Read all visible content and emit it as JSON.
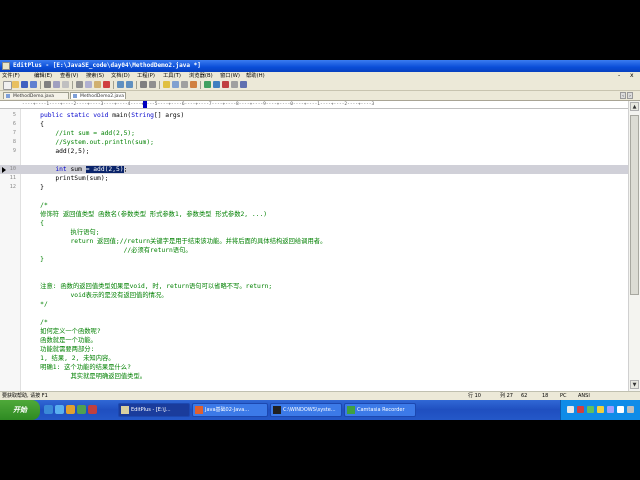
{
  "window": {
    "title": "EditPlus - [E:\\JavaSE_code\\day04\\MethodDemo2.java *]"
  },
  "menu": {
    "items": [
      "文件(F)",
      "编辑(E)",
      "查看(V)",
      "搜索(S)",
      "文档(D)",
      "工程(P)",
      "工具(T)",
      "浏览器(B)",
      "窗口(W)",
      "帮助(H)"
    ],
    "controls": [
      "-",
      "x"
    ]
  },
  "tabs": [
    {
      "label": "MethodDemo.java",
      "active": false
    },
    {
      "label": "MethodDemo2.java",
      "active": true
    }
  ],
  "ruler": {
    "text": "----+----1----+----2----+----3----+----4----+----5----+----6----+----7----+----8----+----9----+----0----+----1----+----2----+----3"
  },
  "editor": {
    "current_line": 10,
    "lines": [
      {
        "n": "5",
        "segs": [
          {
            "t": "    "
          },
          {
            "t": "public",
            "c": "kw"
          },
          {
            "t": " "
          },
          {
            "t": "static",
            "c": "kw"
          },
          {
            "t": " "
          },
          {
            "t": "void",
            "c": "kw"
          },
          {
            "t": " main("
          },
          {
            "t": "String",
            "c": "kw"
          },
          {
            "t": "[] args)"
          }
        ]
      },
      {
        "n": "6",
        "segs": [
          {
            "t": "    {"
          }
        ]
      },
      {
        "n": "7",
        "segs": [
          {
            "t": "        "
          },
          {
            "t": "//int sum = add(2,5);",
            "c": "cm"
          }
        ]
      },
      {
        "n": "8",
        "segs": [
          {
            "t": "        "
          },
          {
            "t": "//System.out.println(sum);",
            "c": "cm"
          }
        ]
      },
      {
        "n": "9",
        "segs": [
          {
            "t": "        add(2,5);"
          }
        ]
      },
      {
        "n": "",
        "segs": []
      },
      {
        "n": "10",
        "segs": [
          {
            "t": "        "
          },
          {
            "t": "int",
            "c": "kw"
          },
          {
            "t": " sum "
          },
          {
            "t": "= add(2,5)",
            "c": "sel"
          },
          {
            "t": ";"
          }
        ]
      },
      {
        "n": "11",
        "segs": [
          {
            "t": "        printSum(sum);"
          }
        ]
      },
      {
        "n": "12",
        "segs": [
          {
            "t": "    }"
          }
        ]
      },
      {
        "n": "",
        "segs": []
      },
      {
        "n": "",
        "segs": [
          {
            "t": "    "
          },
          {
            "t": "/*",
            "c": "cm"
          }
        ]
      },
      {
        "n": "",
        "segs": [
          {
            "t": "    "
          },
          {
            "t": "修饰符 返回值类型 函数名(参数类型 形式参数1, 参数类型 形式参数2, ...)",
            "c": "cm"
          }
        ]
      },
      {
        "n": "",
        "segs": [
          {
            "t": "    "
          },
          {
            "t": "{",
            "c": "cm"
          }
        ]
      },
      {
        "n": "",
        "segs": [
          {
            "t": "            "
          },
          {
            "t": "执行语句;",
            "c": "cm"
          }
        ]
      },
      {
        "n": "",
        "segs": [
          {
            "t": "            "
          },
          {
            "t": "return 返回值;//return关键字是用于结束该功能。并将后面的具体结构返回给调用者。",
            "c": "cm"
          }
        ]
      },
      {
        "n": "",
        "segs": [
          {
            "t": "                          "
          },
          {
            "t": "//必须有return语句。",
            "c": "cm"
          }
        ]
      },
      {
        "n": "",
        "segs": [
          {
            "t": "    "
          },
          {
            "t": "}",
            "c": "cm"
          }
        ]
      },
      {
        "n": "",
        "segs": []
      },
      {
        "n": "",
        "segs": []
      },
      {
        "n": "",
        "segs": [
          {
            "t": "    "
          },
          {
            "t": "注意: 函数的返回值类型如果是void, 时, return语句可以省略不写。return;",
            "c": "cm"
          }
        ]
      },
      {
        "n": "",
        "segs": [
          {
            "t": "            "
          },
          {
            "t": "void表示的是没有返回值的情况。",
            "c": "cm"
          }
        ]
      },
      {
        "n": "",
        "segs": [
          {
            "t": "    "
          },
          {
            "t": "*/",
            "c": "cm"
          }
        ]
      },
      {
        "n": "",
        "segs": []
      },
      {
        "n": "",
        "segs": [
          {
            "t": "    "
          },
          {
            "t": "/*",
            "c": "cm"
          }
        ]
      },
      {
        "n": "",
        "segs": [
          {
            "t": "    "
          },
          {
            "t": "如何定义一个函数呢?",
            "c": "cm"
          }
        ]
      },
      {
        "n": "",
        "segs": [
          {
            "t": "    "
          },
          {
            "t": "函数就是一个功能。",
            "c": "cm"
          }
        ]
      },
      {
        "n": "",
        "segs": [
          {
            "t": "    "
          },
          {
            "t": "功能就需要两部分:",
            "c": "cm"
          }
        ]
      },
      {
        "n": "",
        "segs": [
          {
            "t": "    "
          },
          {
            "t": "1, 结果, 2, 未知内容。",
            "c": "cm"
          }
        ]
      },
      {
        "n": "",
        "segs": [
          {
            "t": "    "
          },
          {
            "t": "明确1: 这个功能的结果是什么?",
            "c": "cm"
          }
        ]
      },
      {
        "n": "",
        "segs": [
          {
            "t": "            "
          },
          {
            "t": "其实就是明确返回值类型。",
            "c": "cm"
          }
        ]
      },
      {
        "n": "",
        "segs": []
      }
    ]
  },
  "status": {
    "hint": "要获取帮助, 请按 F1",
    "line": "行 10",
    "col": "列 27",
    "n1": "62",
    "n2": "18",
    "pc": "PC",
    "enc": "ANSI"
  },
  "taskbar": {
    "start_label": "开始",
    "tasks": [
      {
        "label": "EditPlus - [E:\\J...",
        "active": true
      },
      {
        "label": "Java基础02-Java...",
        "active": false
      },
      {
        "label": "C:\\WINDOWS\\syste...",
        "active": false
      },
      {
        "label": "Camtasia Recorder",
        "active": false
      }
    ]
  }
}
